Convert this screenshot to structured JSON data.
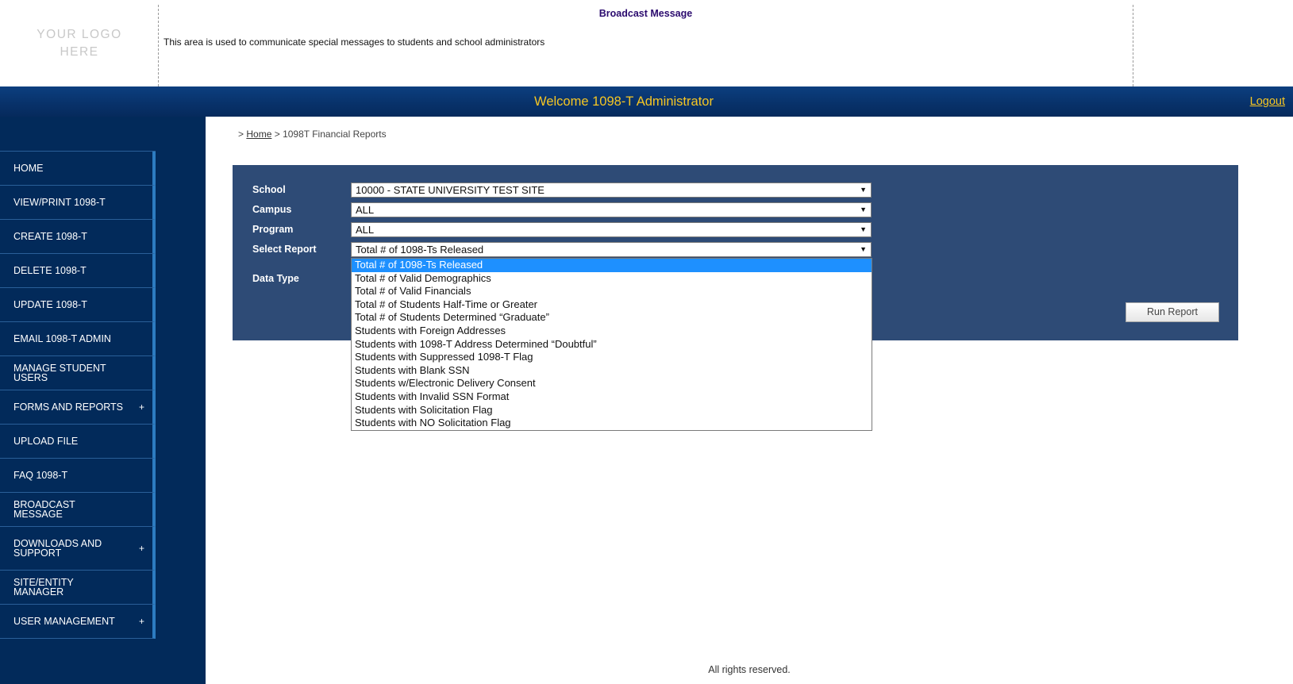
{
  "header": {
    "logo_text": "YOUR LOGO HERE",
    "broadcast_title": "Broadcast Message",
    "broadcast_text": "This area is used to communicate special messages to students and school administrators"
  },
  "topbar": {
    "welcome": "Welcome 1098-T Administrator",
    "logout": "Logout",
    "accent_color": "#f6c623",
    "bar_color": "#083169"
  },
  "sidebar": {
    "background_color": "#022a5a",
    "items": [
      {
        "label": "HOME",
        "expandable": false
      },
      {
        "label": "VIEW/PRINT 1098-T",
        "expandable": false
      },
      {
        "label": "CREATE 1098-T",
        "expandable": false
      },
      {
        "label": "DELETE 1098-T",
        "expandable": false
      },
      {
        "label": "UPDATE 1098-T",
        "expandable": false
      },
      {
        "label": "EMAIL 1098-T ADMIN",
        "expandable": false
      },
      {
        "label": "MANAGE STUDENT USERS",
        "expandable": false
      },
      {
        "label": "FORMS AND REPORTS",
        "expandable": true
      },
      {
        "label": "UPLOAD FILE",
        "expandable": false
      },
      {
        "label": "FAQ 1098-T",
        "expandable": false
      },
      {
        "label": "BROADCAST MESSAGE",
        "expandable": false
      },
      {
        "label": "DOWNLOADS AND SUPPORT",
        "expandable": true
      },
      {
        "label": "SITE/ENTITY MANAGER",
        "expandable": false
      },
      {
        "label": "USER MANAGEMENT",
        "expandable": true
      }
    ],
    "expand_symbol": "+"
  },
  "breadcrumb": {
    "prefix": ">",
    "home": "Home",
    "separator": ">",
    "current": "1098T Financial Reports"
  },
  "form": {
    "panel_color": "#2e4b76",
    "school_label": "School",
    "school_value": "10000 - STATE UNIVERSITY TEST SITE",
    "campus_label": "Campus",
    "campus_value": "ALL",
    "program_label": "Program",
    "program_value": "ALL",
    "report_label": "Select Report",
    "report_value": "Total # of 1098-Ts Released",
    "data_type_label": "Data Type",
    "run_button": "Run Report",
    "arrow_glyph": "▼"
  },
  "report_options": [
    "Total # of 1098-Ts Released",
    "Total # of Valid Demographics",
    "Total # of Valid Financials",
    "Total # of Students Half-Time or Greater",
    "Total # of Students Determined “Graduate”",
    "Students with Foreign Addresses",
    "Students with 1098-T Address Determined “Doubtful”",
    "Students with Suppressed 1098-T Flag",
    "Students with Blank SSN",
    "Students w/Electronic Delivery Consent",
    "Students with Invalid SSN Format",
    "Students with Solicitation Flag",
    "Students with NO Solicitation Flag"
  ],
  "selected_option_index": 0,
  "footer": {
    "text": "All rights reserved."
  }
}
